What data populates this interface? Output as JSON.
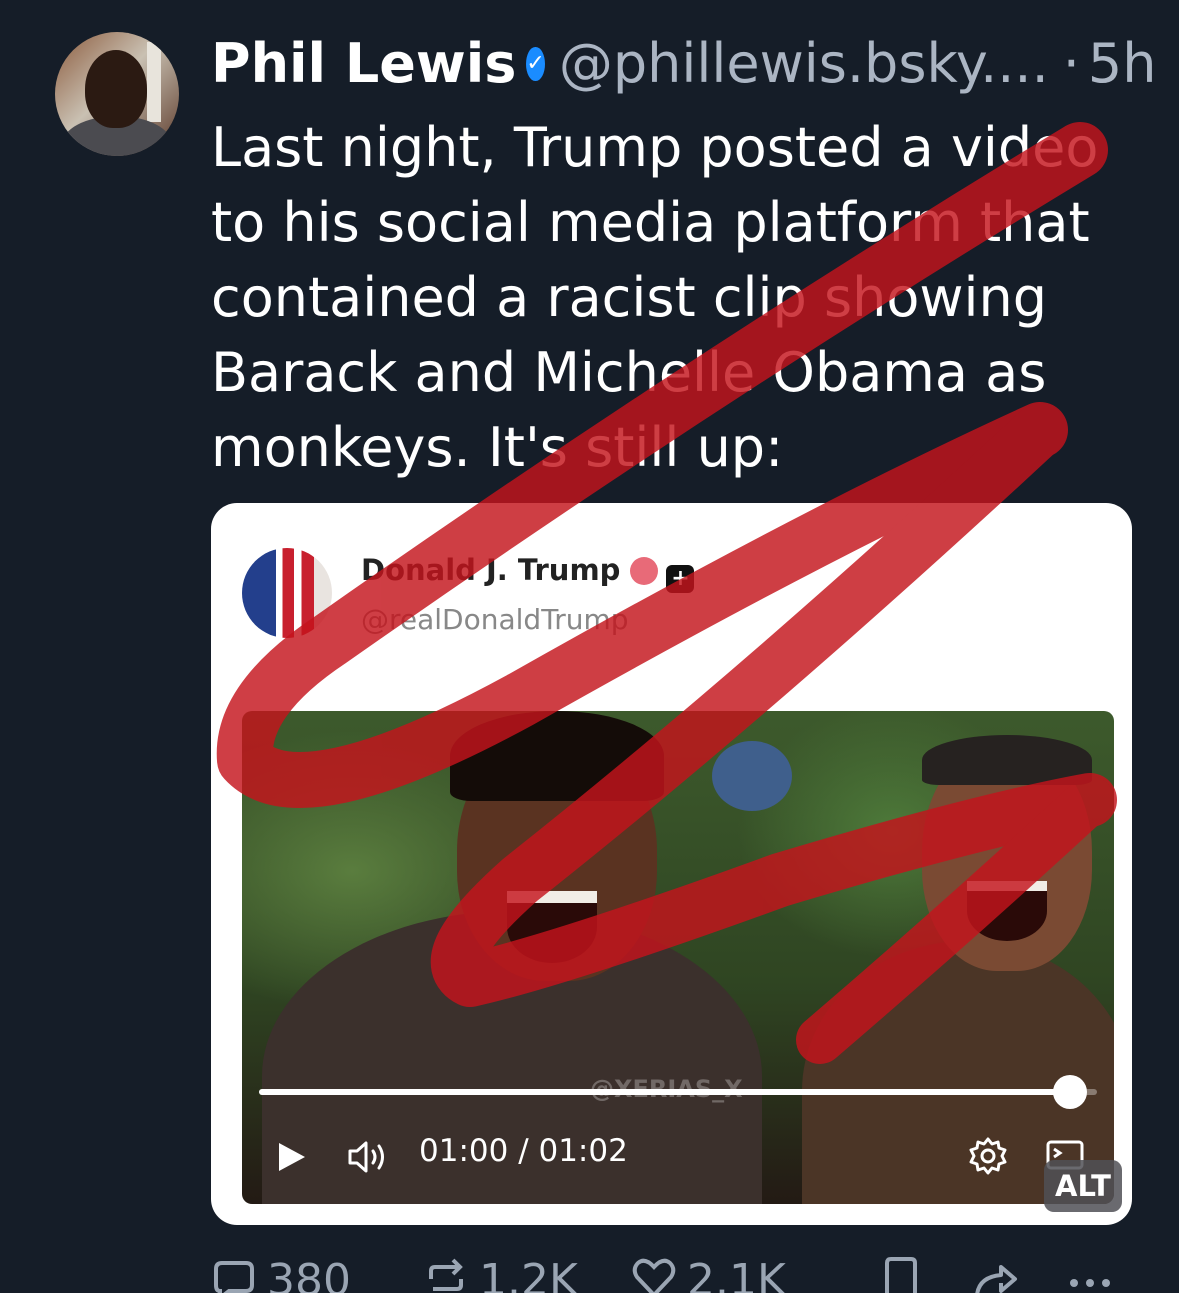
{
  "post": {
    "author_name": "Phil Lewis",
    "handle": "@phillewis.bsky....",
    "separator": "·",
    "time": "5h",
    "text": "Last night, Trump posted a video to his social media platform that contained a racist clip showing Barack and Michelle Obama as monkeys. It's still up:"
  },
  "embed": {
    "author_name": "Donald J. Trump",
    "handle": "@realDonaldTrump",
    "video": {
      "watermark": "@XERIAS_X",
      "time_display": "01:00 / 01:02",
      "progress": 0.968
    },
    "alt_badge": "ALT"
  },
  "actions": {
    "replies": "380",
    "reposts": "1.2K",
    "likes": "2.1K"
  },
  "icons": [
    "verified-icon",
    "play-icon",
    "volume-icon",
    "settings-icon",
    "fullscreen-icon",
    "reply-icon",
    "repost-icon",
    "like-icon",
    "bookmark-icon",
    "share-icon",
    "more-icon"
  ],
  "colors": {
    "background": "#151d28",
    "secondary_text": "#abb5c3",
    "verified": "#1a8cff",
    "scribble": "#c4141c"
  }
}
